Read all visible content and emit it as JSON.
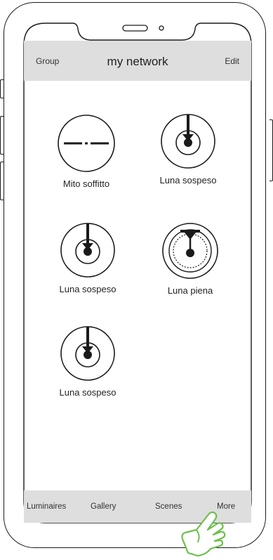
{
  "header": {
    "left_label": "Group",
    "title": "my network",
    "right_label": "Edit"
  },
  "luminaires": [
    {
      "label": "Mito soffitto",
      "icon": "mito-soffitto-icon"
    },
    {
      "label": "Luna sospeso",
      "icon": "luna-sospeso-icon"
    },
    {
      "label": "Luna sospeso",
      "icon": "luna-sospeso-icon"
    },
    {
      "label": "Luna piena",
      "icon": "luna-piena-icon"
    },
    {
      "label": "Luna sospeso",
      "icon": "luna-sospeso-icon"
    }
  ],
  "tabbar": {
    "tabs": [
      "Luminaires",
      "Gallery",
      "Scenes",
      "More"
    ]
  },
  "colors": {
    "bar": "#dedede",
    "stroke": "#1a1a1a",
    "hand": "#6cc04a"
  }
}
